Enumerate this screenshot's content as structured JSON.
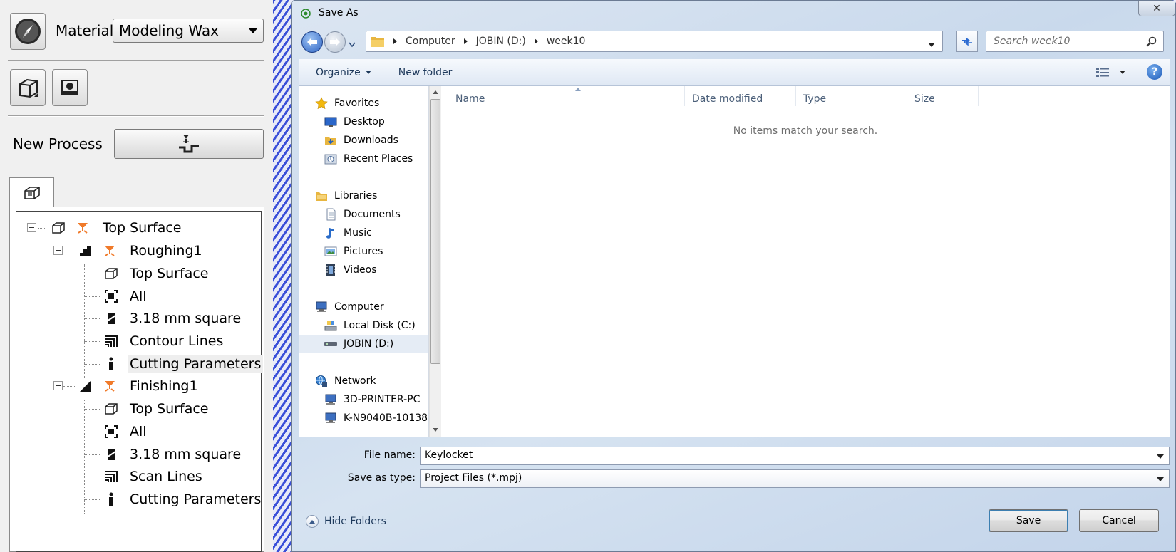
{
  "app_panel": {
    "material_label": "Material",
    "material_value": "Modeling Wax",
    "new_process_label": "New Process",
    "tree": [
      {
        "label": "Top Surface",
        "icon": "toolpath-icon",
        "level": 0
      },
      {
        "label": "Roughing1",
        "icon": "roughing-icon",
        "level": 1
      },
      {
        "label": "Top Surface",
        "icon": "surface-icon",
        "level": 2
      },
      {
        "label": "All",
        "icon": "area-icon",
        "level": 2
      },
      {
        "label": "3.18 mm square",
        "icon": "tool-icon",
        "level": 2
      },
      {
        "label": "Contour Lines",
        "icon": "lines-icon",
        "level": 2
      },
      {
        "label": "Cutting Parameters",
        "icon": "info-icon",
        "level": 2,
        "selected": true
      },
      {
        "label": "Finishing1",
        "icon": "finishing-icon",
        "level": 1
      },
      {
        "label": "Top Surface",
        "icon": "surface-icon",
        "level": 2
      },
      {
        "label": "All",
        "icon": "area-icon",
        "level": 2
      },
      {
        "label": "3.18 mm square",
        "icon": "tool-icon",
        "level": 2
      },
      {
        "label": "Scan Lines",
        "icon": "lines-icon",
        "level": 2
      },
      {
        "label": "Cutting Parameters",
        "icon": "info-icon",
        "level": 2
      }
    ]
  },
  "dialog": {
    "title": "Save As",
    "close_label": "✕",
    "breadcrumb": [
      "Computer",
      "JOBIN (D:)",
      "week10"
    ],
    "search_placeholder": "Search week10",
    "toolbar": {
      "organize": "Organize",
      "new_folder": "New folder",
      "help": "?"
    },
    "nav": {
      "favorites": "Favorites",
      "desktop": "Desktop",
      "downloads": "Downloads",
      "recent_places": "Recent Places",
      "libraries": "Libraries",
      "documents": "Documents",
      "music": "Music",
      "pictures": "Pictures",
      "videos": "Videos",
      "computer": "Computer",
      "local_disk": "Local Disk (C:)",
      "jobin": "JOBIN (D:)",
      "network": "Network",
      "printer_pc": "3D-PRINTER-PC",
      "k_pc": "K-N9040B-10138"
    },
    "columns": {
      "name": "Name",
      "date_modified": "Date modified",
      "type": "Type",
      "size": "Size"
    },
    "empty_message": "No items match your search.",
    "file_name_label": "File name:",
    "file_name_value": "Keylocket",
    "save_type_label": "Save as type:",
    "save_type_value": "Project Files (*.mpj)",
    "hide_folders": "Hide Folders",
    "save_label": "Save",
    "cancel_label": "Cancel"
  }
}
